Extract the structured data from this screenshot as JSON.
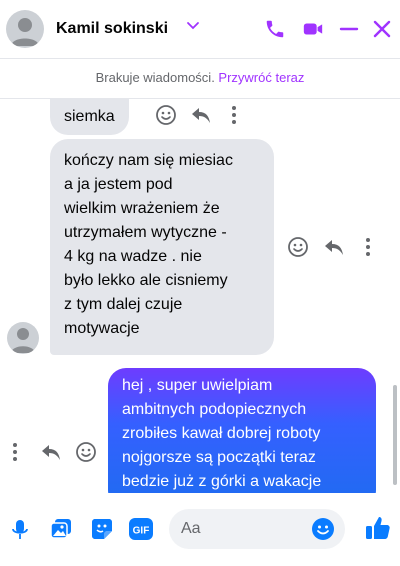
{
  "header": {
    "contact_name": "Kamil sokinski"
  },
  "banner": {
    "text": "Brakuje wiadomości. ",
    "restore_link": "Przywróć teraz"
  },
  "messages": [
    {
      "sender": "contact",
      "lines": [
        "siemka"
      ]
    },
    {
      "sender": "contact",
      "lines": [
        "kończy nam się miesiac",
        "a ja jestem pod",
        "wielkim wrażeniem że",
        "utrzymałem wytyczne -",
        "4 kg na wadze . nie",
        "było lekko ale cisniemy",
        "z tym dalej czuje",
        "motywacje"
      ]
    },
    {
      "sender": "me",
      "lines": [
        "hej , super uwielpiam",
        "ambitnych podopiecznych",
        "zrobiłes kawał dobrej roboty",
        "nojgorsze są początki teraz",
        "bedzie już z górki a wakacje"
      ]
    }
  ],
  "composer": {
    "placeholder": "Aa",
    "gif_label": "GIF"
  },
  "colors": {
    "accent": "#a033ff",
    "composer_accent": "#0a7cff",
    "outgoing_bubble_top": "#6e3cff",
    "outgoing_bubble_bottom": "#1e6cf0",
    "incoming_bubble": "#e4e6eb"
  },
  "icons": {
    "header": [
      "chevron-down-icon",
      "phone-icon",
      "video-camera-icon",
      "minimize-icon",
      "close-icon"
    ],
    "message_actions": [
      "emoji-react-icon",
      "reply-icon",
      "more-options-icon"
    ],
    "composer": [
      "microphone-icon",
      "photo-icon",
      "sticker-icon",
      "gif-icon",
      "emoji-icon",
      "thumbs-up-icon"
    ]
  }
}
